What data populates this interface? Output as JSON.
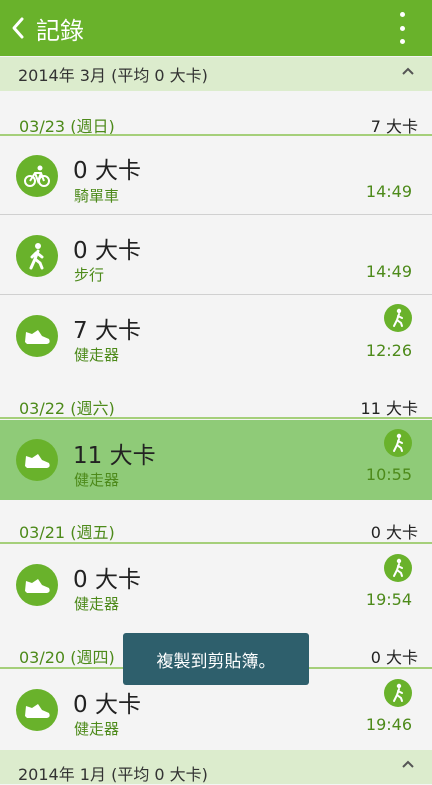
{
  "appbar": {
    "title": "記錄"
  },
  "months": [
    {
      "label": "2014年 3月 (平均 0 大卡)"
    },
    {
      "label": "2014年 1月 (平均 0 大卡)"
    }
  ],
  "days": [
    {
      "date": "03/23 (週日)",
      "total": "7 大卡"
    },
    {
      "date": "03/22 (週六)",
      "total": "11 大卡"
    },
    {
      "date": "03/21 (週五)",
      "total": "0 大卡"
    },
    {
      "date": "03/20 (週四)",
      "total": "0 大卡"
    }
  ],
  "records": [
    {
      "kcal": "0 大卡",
      "activity": "騎單車",
      "time": "14:49",
      "icon": "bicycle-icon"
    },
    {
      "kcal": "0 大卡",
      "activity": "步行",
      "time": "14:49",
      "icon": "walking-icon"
    },
    {
      "kcal": "7 大卡",
      "activity": "健走器",
      "time": "12:26",
      "icon": "shoe-icon",
      "badge": "walker-badge-icon"
    },
    {
      "kcal": "11 大卡",
      "activity": "健走器",
      "time": "10:55",
      "icon": "shoe-icon",
      "badge": "walker-badge-icon"
    },
    {
      "kcal": "0 大卡",
      "activity": "健走器",
      "time": "19:54",
      "icon": "shoe-icon",
      "badge": "walker-badge-icon"
    },
    {
      "kcal": "0 大卡",
      "activity": "健走器",
      "time": "19:46",
      "icon": "shoe-icon",
      "badge": "walker-badge-icon"
    }
  ],
  "toast": {
    "text": "複製到剪貼簿。"
  },
  "colors": {
    "accent": "#69b22b",
    "selected_row": "#8fcb78",
    "month_header": "#dceccd",
    "toast": "#2e5f6c"
  }
}
